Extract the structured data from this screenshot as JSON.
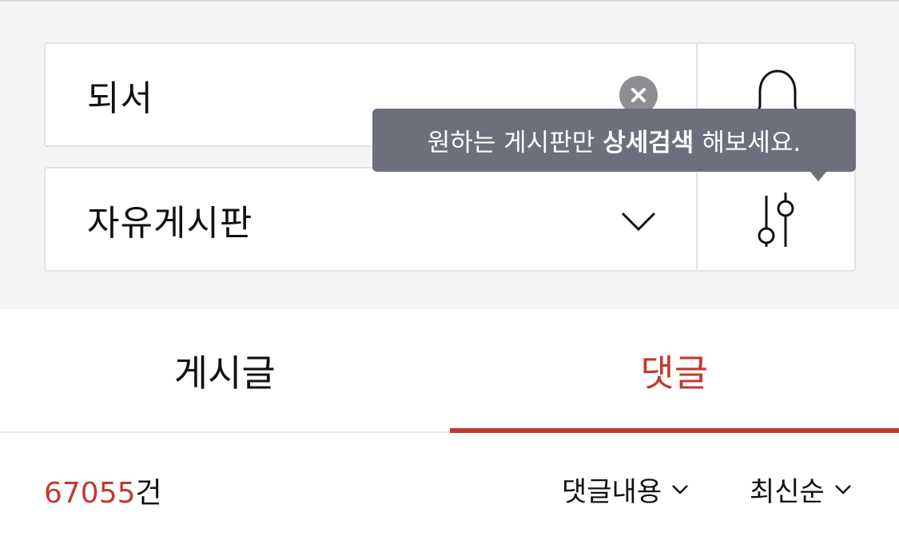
{
  "search": {
    "keyword": "되서",
    "board": "자유게시판"
  },
  "tooltip": {
    "before": "원하는 게시판만",
    "emphasis": "상세검색",
    "after": "해보세요."
  },
  "tabs": [
    {
      "label": "게시글",
      "active": false
    },
    {
      "label": "댓글",
      "active": true
    }
  ],
  "results": {
    "count": "67055",
    "unit": "건",
    "scope_label": "댓글내용",
    "order_label": "최신순"
  },
  "colors": {
    "accent": "#c13a30",
    "tooltip_bg": "#6e6f7c",
    "panel_bg": "#f4f4f6"
  }
}
